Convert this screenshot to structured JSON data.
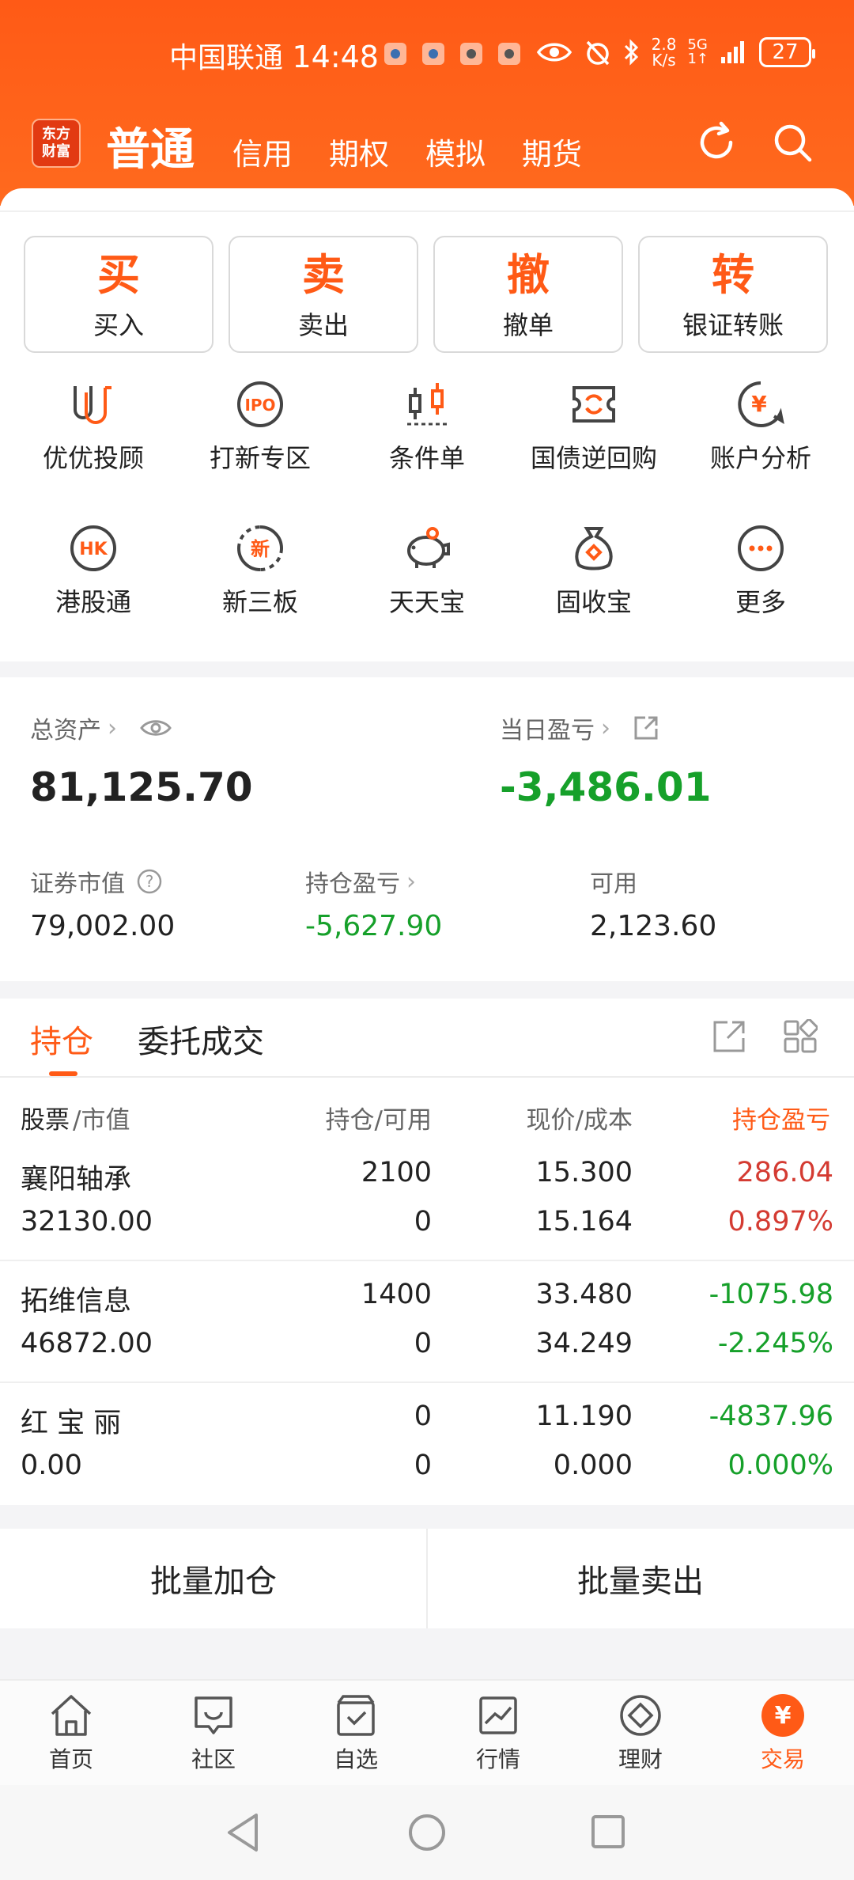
{
  "status_bar": {
    "carrier": "中国联通",
    "time": "14:48",
    "speed_top": "2.8",
    "speed_bottom": "K/s",
    "network_top": "5G",
    "network_bottom": "1↑",
    "battery": "27"
  },
  "header": {
    "logo_line1": "东方",
    "logo_line2": "财富",
    "tabs": [
      "普通",
      "信用",
      "期权",
      "模拟",
      "期货"
    ]
  },
  "actions_top": [
    {
      "char": "买",
      "label": "买入"
    },
    {
      "char": "卖",
      "label": "卖出"
    },
    {
      "char": "撤",
      "label": "撤单"
    },
    {
      "char": "转",
      "label": "银证转账"
    }
  ],
  "grid": [
    {
      "label": "优优投顾",
      "icon": "uu-icon"
    },
    {
      "label": "打新专区",
      "icon": "ipo-icon",
      "badge": "IPO"
    },
    {
      "label": "条件单",
      "icon": "candlestick-icon"
    },
    {
      "label": "国债逆回购",
      "icon": "repo-icon"
    },
    {
      "label": "账户分析",
      "icon": "yen-chat-icon",
      "badge": "¥"
    },
    {
      "label": "港股通",
      "icon": "hk-icon",
      "badge": "HK"
    },
    {
      "label": "新三板",
      "icon": "new-board-icon",
      "badge": "新"
    },
    {
      "label": "天天宝",
      "icon": "piggy-bank-icon"
    },
    {
      "label": "固收宝",
      "icon": "money-bag-icon"
    },
    {
      "label": "更多",
      "icon": "more-icon"
    }
  ],
  "account": {
    "total_assets_label": "总资产",
    "total_assets": "81,125.70",
    "daily_pnl_label": "当日盈亏",
    "daily_pnl": "-3,486.01",
    "market_value_label": "证券市值",
    "market_value": "79,002.00",
    "position_pnl_label": "持仓盈亏",
    "position_pnl": "-5,627.90",
    "available_label": "可用",
    "available": "2,123.60"
  },
  "holdings": {
    "tabs": [
      "持仓",
      "委托成交"
    ],
    "columns": {
      "stock": "股票",
      "market_value": "/市值",
      "position": "持仓/可用",
      "price": "现价/成本",
      "pnl": "持仓盈亏"
    },
    "rows": [
      {
        "name": "襄阳轴承",
        "value": "32130.00",
        "position": "2100",
        "available": "0",
        "price": "15.300",
        "cost": "15.164",
        "pnl": "286.04",
        "pnl_pct": "0.897%",
        "dir": "up"
      },
      {
        "name": "拓维信息",
        "value": "46872.00",
        "position": "1400",
        "available": "0",
        "price": "33.480",
        "cost": "34.249",
        "pnl": "-1075.98",
        "pnl_pct": "-2.245%",
        "dir": "down"
      },
      {
        "name": "红 宝 丽",
        "value": "0.00",
        "position": "0",
        "available": "0",
        "price": "11.190",
        "cost": "0.000",
        "pnl": "-4837.96",
        "pnl_pct": "0.000%",
        "dir": "down"
      }
    ]
  },
  "batch": {
    "add": "批量加仓",
    "sell": "批量卖出"
  },
  "bottom_nav": [
    {
      "label": "首页"
    },
    {
      "label": "社区"
    },
    {
      "label": "自选"
    },
    {
      "label": "行情"
    },
    {
      "label": "理财"
    },
    {
      "label": "交易",
      "badge": "¥"
    }
  ],
  "colors": {
    "brand": "#ff5a16",
    "up": "#d43b32",
    "down": "#16a02a"
  }
}
